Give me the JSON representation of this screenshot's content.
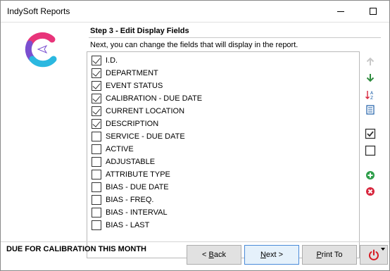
{
  "window": {
    "title": "IndySoft Reports"
  },
  "step": {
    "title": "Step 3 - Edit Display Fields",
    "description": "Next, you can change the fields that will display in the report."
  },
  "fields": [
    {
      "label": "I.D.",
      "checked": true
    },
    {
      "label": "DEPARTMENT",
      "checked": true
    },
    {
      "label": "EVENT STATUS",
      "checked": true
    },
    {
      "label": "CALIBRATION - DUE DATE",
      "checked": true
    },
    {
      "label": "CURRENT LOCATION",
      "checked": true
    },
    {
      "label": "DESCRIPTION",
      "checked": true
    },
    {
      "label": "SERVICE - DUE DATE",
      "checked": false
    },
    {
      "label": "ACTIVE",
      "checked": false
    },
    {
      "label": "ADJUSTABLE",
      "checked": false
    },
    {
      "label": "ATTRIBUTE TYPE",
      "checked": false
    },
    {
      "label": "BIAS - DUE DATE",
      "checked": false
    },
    {
      "label": "BIAS - FREQ.",
      "checked": false
    },
    {
      "label": "BIAS - INTERVAL",
      "checked": false
    },
    {
      "label": "BIAS - LAST",
      "checked": false
    }
  ],
  "tools": [
    {
      "name": "move-up-icon",
      "color": "#c8c8c8"
    },
    {
      "name": "move-down-icon",
      "color": "#2e8b3e"
    },
    {
      "name": "sort-az-icon",
      "color": "#1e5fa8"
    },
    {
      "name": "list-view-icon",
      "color": "#1e5fa8"
    },
    {
      "name": "check-all-icon",
      "color": "#333333"
    },
    {
      "name": "uncheck-all-icon",
      "color": "#333333"
    },
    {
      "name": "add-field-icon",
      "color": "#2e9e4a"
    },
    {
      "name": "remove-field-icon",
      "color": "#d7263d"
    }
  ],
  "footer": {
    "report_name": "DUE FOR CALIBRATION THIS MONTH",
    "back_prefix": "< ",
    "back_hot": "B",
    "back_rest": "ack",
    "next_hot": "N",
    "next_rest": "ext >",
    "print_hot": "P",
    "print_rest": "rint To"
  },
  "colors": {
    "logo_pink": "#e8347a",
    "logo_purple": "#7a4fd0",
    "logo_cyan": "#2bb8e0",
    "power_red": "#d71920"
  }
}
